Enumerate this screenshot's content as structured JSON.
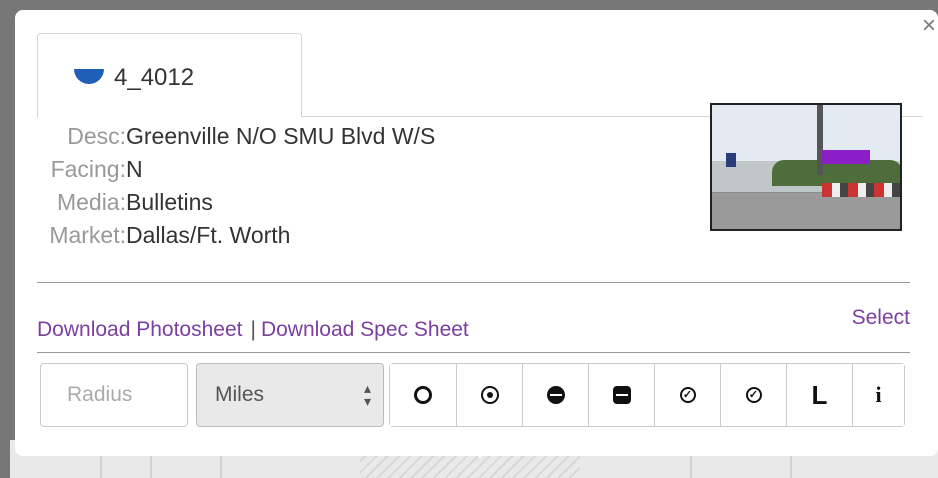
{
  "popup": {
    "close_label": "×",
    "tab": {
      "label": "4_4012",
      "icon": "half-circle-marker-icon",
      "icon_color": "#1f5fb8"
    },
    "details": [
      {
        "key": "Desc:",
        "value": "Greenville N/O SMU Blvd W/S"
      },
      {
        "key": "Facing:",
        "value": "N"
      },
      {
        "key": "Media:",
        "value": "Bulletins"
      },
      {
        "key": "Market:",
        "value": "Dallas/Ft. Worth"
      }
    ],
    "photo": {
      "alt": "billboard photo"
    },
    "links": {
      "photosheet": "Download Photosheet",
      "separator": "|",
      "specsheet": "Download Spec Sheet",
      "select": "Select"
    },
    "toolbar": {
      "radius_placeholder": "Radius",
      "units_value": "Miles",
      "tools": [
        {
          "icon": "circle-outline-icon"
        },
        {
          "icon": "circle-target-icon"
        },
        {
          "icon": "circle-minus-icon"
        },
        {
          "icon": "square-minus-icon"
        },
        {
          "icon": "check-circle-icon"
        },
        {
          "icon": "check-circle-icon"
        },
        {
          "icon": "letter-L-icon",
          "label": "L"
        },
        {
          "icon": "info-icon",
          "label": "i"
        }
      ]
    }
  },
  "colors": {
    "link": "#7b3fa0",
    "accent": "#1f5fb8"
  }
}
